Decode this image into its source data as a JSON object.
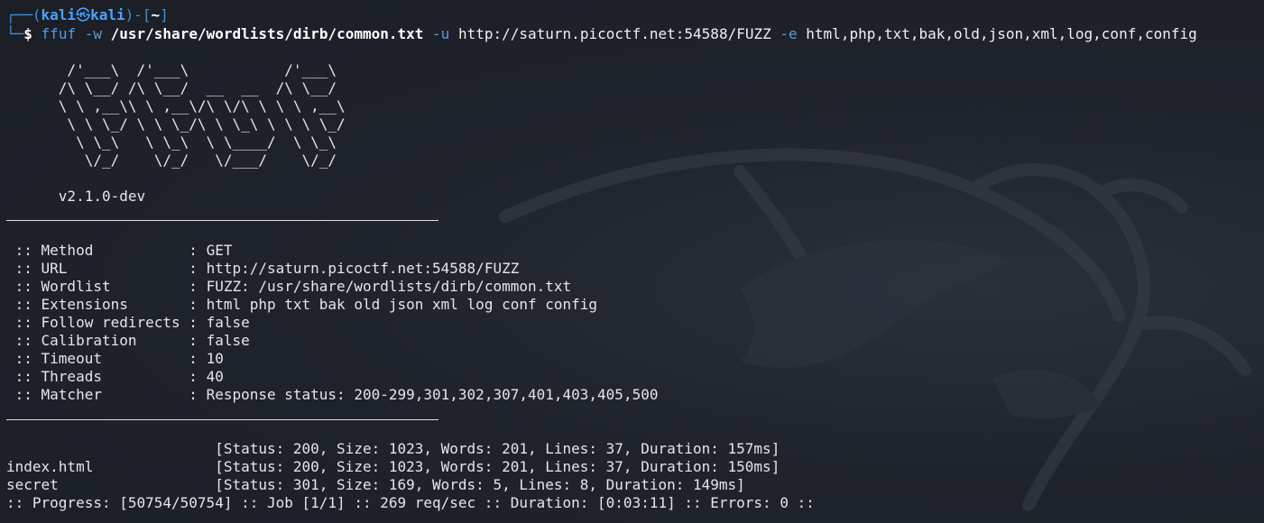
{
  "prompt": {
    "line1_prefix": "┌──(",
    "user": "kali",
    "at_symbol": "㉿",
    "host": "kali",
    "line1_mid": ")-[",
    "dir": "~",
    "line1_suffix": "]",
    "line2_prefix": "└─",
    "dollar": "$"
  },
  "command": {
    "program": "ffuf",
    "flag_w": "-w",
    "wordlist": "/usr/share/wordlists/dirb/common.txt",
    "flag_u": "-u",
    "url": "http://saturn.picoctf.net:54588/FUZZ",
    "flag_e": "-e",
    "extensions": "html,php,txt,bak,old,json,xml,log,conf,config"
  },
  "banner": {
    "ascii": [
      "       /'___\\  /'___\\           /'___\\",
      "      /\\ \\__/ /\\ \\__/  __  __  /\\ \\__/",
      "      \\ \\ ,__\\\\ \\ ,__\\/\\ \\/\\ \\ \\ \\ ,__\\",
      "       \\ \\ \\_/ \\ \\ \\_/\\ \\ \\_\\ \\ \\ \\ \\_/",
      "        \\ \\_\\   \\ \\_\\  \\ \\____/  \\ \\_\\",
      "         \\/_/    \\/_/   \\/___/    \\/_/"
    ],
    "version": "      v2.1.0-dev"
  },
  "config": [
    {
      "key": " :: Method           : ",
      "value": "GET"
    },
    {
      "key": " :: URL              : ",
      "value": "http://saturn.picoctf.net:54588/FUZZ"
    },
    {
      "key": " :: Wordlist         : ",
      "value": "FUZZ: /usr/share/wordlists/dirb/common.txt"
    },
    {
      "key": " :: Extensions       : ",
      "value": "html php txt bak old json xml log conf config"
    },
    {
      "key": " :: Follow redirects : ",
      "value": "false"
    },
    {
      "key": " :: Calibration      : ",
      "value": "false"
    },
    {
      "key": " :: Timeout          : ",
      "value": "10"
    },
    {
      "key": " :: Threads          : ",
      "value": "40"
    },
    {
      "key": " :: Matcher          : ",
      "value": "Response status: 200-299,301,302,307,401,403,405,500"
    }
  ],
  "results": [
    {
      "name": "                        ",
      "status": "[Status: 200, Size: 1023, Words: 201, Lines: 37, Duration: 157ms]"
    },
    {
      "name": "index.html              ",
      "status": "[Status: 200, Size: 1023, Words: 201, Lines: 37, Duration: 150ms]"
    },
    {
      "name": "secret                  ",
      "status": "[Status: 301, Size: 169, Words: 5, Lines: 8, Duration: 149ms]"
    }
  ],
  "progress": ":: Progress: [50754/50754] :: Job [1/1] :: 269 req/sec :: Duration: [0:03:11] :: Errors: 0 ::"
}
